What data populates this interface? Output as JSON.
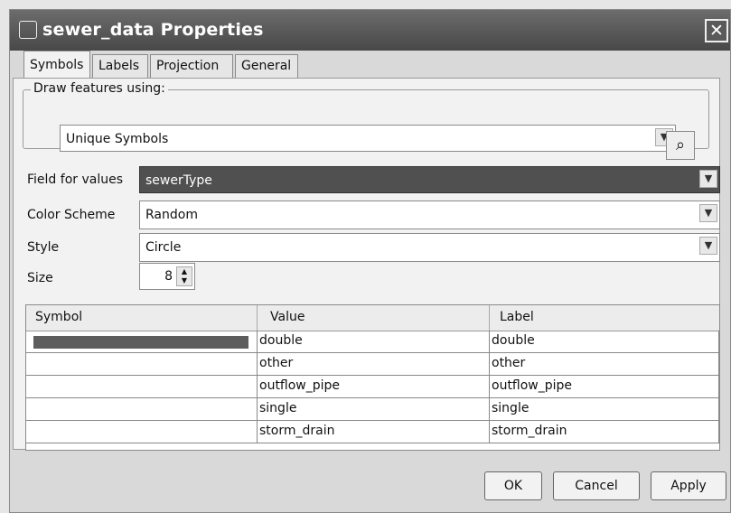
{
  "window": {
    "title": "sewer_data Properties",
    "close_glyph": "✕"
  },
  "tabs": [
    {
      "label": "Symbols"
    },
    {
      "label": "Labels"
    },
    {
      "label": "Projection"
    },
    {
      "label": "General"
    }
  ],
  "draw_features": {
    "legend": "Draw features using:",
    "selected": "Unique Symbols"
  },
  "field_for_values": {
    "label": "Field for values",
    "value": "sewerType"
  },
  "color_scheme": {
    "label": "Color Scheme",
    "value": "Random"
  },
  "style": {
    "label": "Style",
    "value": "Circle"
  },
  "size": {
    "label": "Size",
    "value": "8"
  },
  "table": {
    "headers": [
      "Symbol",
      "Value",
      "Label"
    ],
    "rows": [
      {
        "value": "double",
        "label": "double",
        "has_swatch": true,
        "swatch_color": "#5d5d5d"
      },
      {
        "value": "other",
        "label": "other"
      },
      {
        "value": "outflow_pipe",
        "label": "outflow_pipe"
      },
      {
        "value": "single",
        "label": "single"
      },
      {
        "value": "storm_drain",
        "label": "storm_drain"
      }
    ]
  },
  "buttons": {
    "ok": "OK",
    "cancel": "Cancel",
    "apply": "Apply"
  }
}
